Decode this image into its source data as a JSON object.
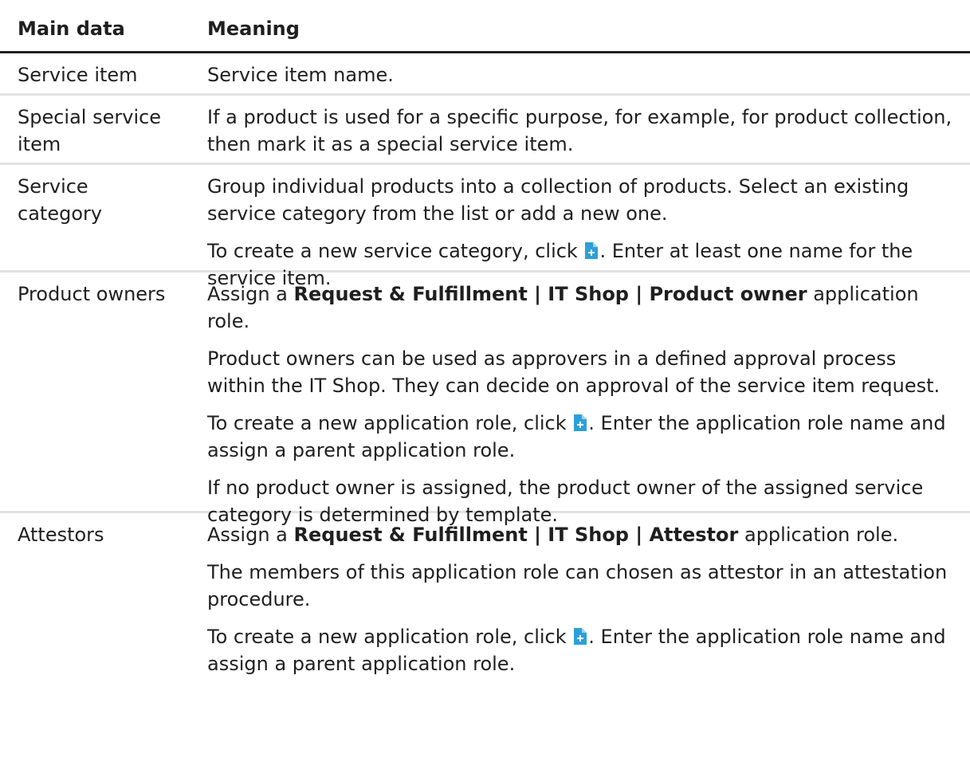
{
  "header": {
    "col1": "Main data",
    "col2": "Meaning"
  },
  "rows": [
    {
      "key": "Service item",
      "p1": "Service item name."
    },
    {
      "key": "Special service item",
      "p1": "If a product is used for a specific purpose, for example, for product collection, then mark it as a special service item."
    },
    {
      "key": "Service category",
      "p1": "Group individual products into a collection of products. Select an existing service category from the list or add a new one.",
      "p2_before": "To create a new service category, click",
      "p2_after": ". Enter at least one name for the service item."
    },
    {
      "key": "Product owners",
      "p1_before": "Assign a",
      "p1_bold": "Request & Fulfillment | IT Shop | Product owner",
      "p1_after": "applic­ation role.",
      "p2": "Product owners can be used as approvers in a defined approval process within the IT Shop. They can decide on approval of the service item request.",
      "p3_before": "To create a new application role, click",
      "p3_after": ". Enter the application role name and assign a parent application role.",
      "p4": "If no product owner is assigned, the product owner of the assigned service category is determined by template."
    },
    {
      "key": "Attestors",
      "p1_before": "Assign a",
      "p1_bold": "Request & Fulfillment | IT Shop | Attestor",
      "p1_after": "application role.",
      "p2": "The members of this application role can chosen as attestor in an attest­ation procedure.",
      "p3_before": "To create a new application role, click",
      "p3_after": ". Enter the application role name and assign a parent application role."
    }
  ],
  "icons": {
    "add": "add-document-icon"
  },
  "colors": {
    "icon_blue": "#2d9fd9",
    "text": "#1f1f1f",
    "rule": "#e2e2e2"
  }
}
